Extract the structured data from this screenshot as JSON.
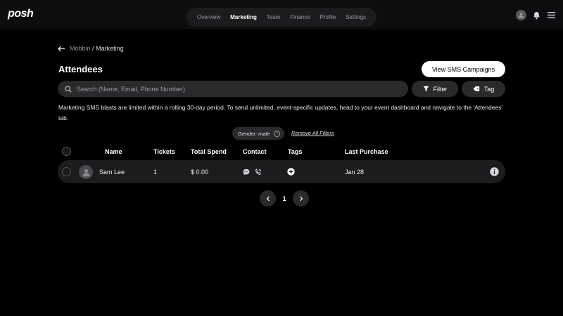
{
  "header": {
    "logo": "posh",
    "nav": [
      "Overview",
      "Marketing",
      "Team",
      "Finance",
      "Profile",
      "Settings"
    ],
    "active_nav": "Marketing",
    "icons": [
      "avatar",
      "bell-icon",
      "menu-icon"
    ]
  },
  "breadcrumb": {
    "parent": "Mobbin",
    "separator": "/",
    "current": "Marketing"
  },
  "page": {
    "title": "Attendees",
    "sms_button": "View SMS Campaigns"
  },
  "toolbar": {
    "search_placeholder": "Search (Name, Email, Phone Number)",
    "filter_label": "Filter",
    "tag_label": "Tag"
  },
  "notice": "Marketing SMS blasts are limited within a rolling 30-day period. To send unlimited, event-specific updates, head to your event dashboard and navigate to the 'Attendees' tab.",
  "filters": {
    "active": "Gender: male",
    "remove_all": "Remove All Filters"
  },
  "table": {
    "columns": [
      "Name",
      "Tickets",
      "Total Spend",
      "Contact",
      "Tags",
      "Last Purchase"
    ],
    "rows": [
      {
        "name": "Sam Lee",
        "tickets": "1",
        "total_spend": "$ 0.00",
        "last_purchase": "Jan 28"
      }
    ]
  },
  "pagination": {
    "current": "1"
  },
  "colors": {
    "background": "#000000",
    "surface": "#1c1c1f",
    "control": "#2a2a2d",
    "accent": "#ffffff"
  }
}
